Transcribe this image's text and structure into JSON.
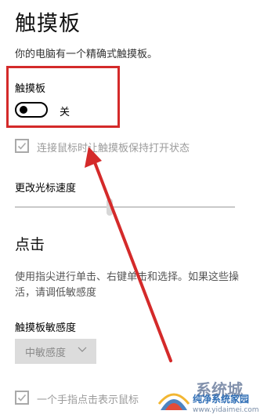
{
  "page": {
    "title": "触摸板",
    "subtitle": "你的电脑有一个精确式触摸板。"
  },
  "touchpad_toggle": {
    "label": "触摸板",
    "state": "关",
    "on": false
  },
  "mouse_connected_option": {
    "label": "连接鼠标时让触摸板保持打开状态",
    "checked": true,
    "enabled": false
  },
  "cursor_speed": {
    "label": "更改光标速度",
    "level": 0.43
  },
  "tap_section": {
    "heading": "点击",
    "description_line1": "使用指尖进行单击、右键单击和选择。如果这些操",
    "description_line2": "活，请调低敏感度",
    "sensitivity_label": "触摸板敏感度",
    "sensitivity_value": "中敏感度",
    "single_tap_label": "一个手指点击表示鼠标",
    "single_tap_checked": true
  },
  "annotation": {
    "color": "#d42a2a"
  },
  "watermark": {
    "logo_text": "系统城",
    "site_name": "纯净系统家园",
    "url": "www.yidaimei.com"
  }
}
